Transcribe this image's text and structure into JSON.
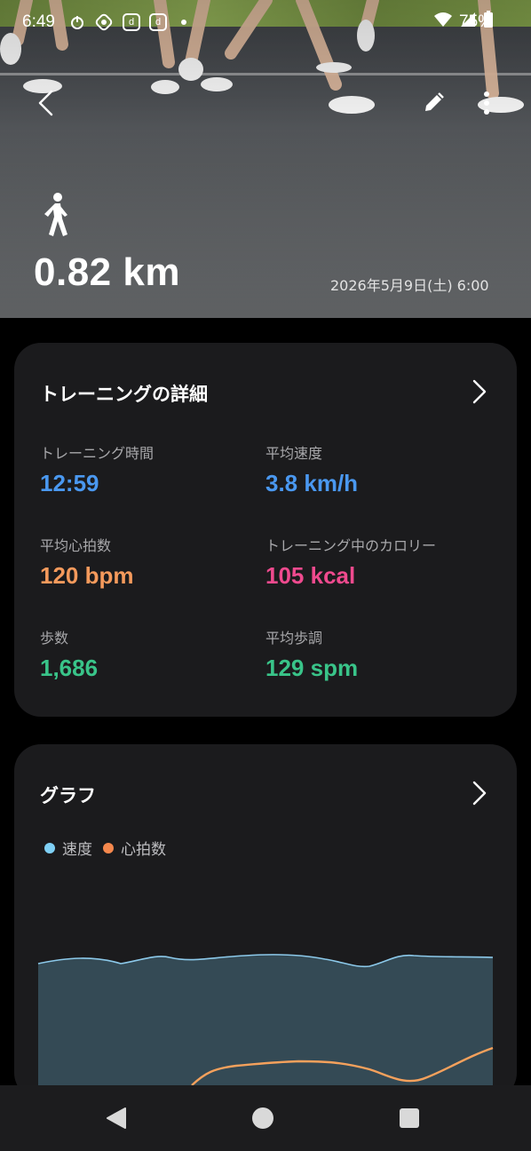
{
  "status_bar": {
    "time": "6:49",
    "battery": "75%",
    "notif_icons": [
      "power-icon",
      "sync-icon",
      "d-app-icon",
      "d-app-icon",
      "dot-icon"
    ],
    "d_label": "d"
  },
  "hero": {
    "activity_icon": "walking-icon",
    "distance": "0.82 km",
    "datetime": "2026年5月9日(土) 6:00"
  },
  "details": {
    "title": "トレーニングの詳細",
    "metrics": [
      {
        "label": "トレーニング時間",
        "value": "12:59",
        "color": "#4a98f0"
      },
      {
        "label": "平均速度",
        "value": "3.8 km/h",
        "color": "#4a98f0"
      },
      {
        "label": "平均心拍数",
        "value": "120 bpm",
        "color": "#f59a5c"
      },
      {
        "label": "トレーニング中のカロリー",
        "value": "105 kcal",
        "color": "#ef4a8e"
      },
      {
        "label": "歩数",
        "value": "1,686",
        "color": "#39c489"
      },
      {
        "label": "平均歩調",
        "value": "129 spm",
        "color": "#39c489"
      }
    ]
  },
  "graph": {
    "title": "グラフ",
    "legend": [
      {
        "label": "速度",
        "color": "#7fd0f5"
      },
      {
        "label": "心拍数",
        "color": "#f5a15c"
      }
    ]
  },
  "colors": {
    "background": "#000000",
    "card": "#1b1b1d",
    "speed_fill": "#344a55",
    "speed_line": "#8cc9ea",
    "heart_line": "#f5a15c"
  }
}
